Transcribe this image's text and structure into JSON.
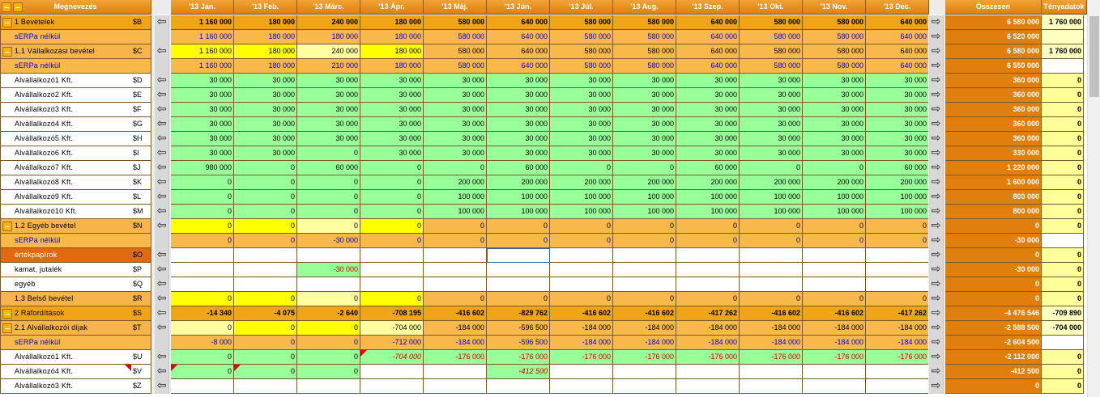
{
  "header": {
    "name": "Megnevezés",
    "months": [
      "'13 Jan.",
      "'13 Feb.",
      "'13 Márc.",
      "'13 Ápr.",
      "'13 Máj.",
      "'13 Jún.",
      "'13 Júl.",
      "'13 Aug.",
      "'13 Szep.",
      "'13 Okt.",
      "'13 Nov.",
      "'13 Dec."
    ],
    "sum": "Összesen",
    "actual": "Tényadatok"
  },
  "icons": {
    "arrow_left": "left-arrow-icon",
    "arrow_right": "right-arrow-icon",
    "collapse": "minus-icon"
  },
  "colors": {
    "header": "#e58e16",
    "total": "#e07f0d",
    "green": "#99ff99",
    "light_yellow": "#ffff99",
    "yellow": "#ffff00",
    "orange": "#f0a020",
    "light_orange": "#f8b84a",
    "blue_text": "#0000cc",
    "red_text": "#cc0000"
  },
  "rows": [
    {
      "label": "1 Bevételek",
      "key": "$B",
      "collapse": true,
      "style": "orange",
      "values": [
        "1 160 000",
        "180 000",
        "240 000",
        "180 000",
        "580 000",
        "640 000",
        "580 000",
        "580 000",
        "640 000",
        "580 000",
        "580 000",
        "640 000"
      ],
      "sum": "6 580 000",
      "actual": "1 760 000",
      "actual_bg": "#ffffc0"
    },
    {
      "label": "sERPa nélkül",
      "key": "",
      "style": "serpa",
      "values": [
        "1 160 000",
        "180 000",
        "180 000",
        "180 000",
        "580 000",
        "640 000",
        "580 000",
        "580 000",
        "640 000",
        "580 000",
        "580 000",
        "640 000"
      ],
      "sum": "6 520 000",
      "actual": "",
      "actual_bg": "#ffffc0"
    },
    {
      "label": "1.1 Vállalkozási bevétel",
      "key": "$C",
      "collapse": true,
      "style": "orange2",
      "values": [
        "1 160 000",
        "180 000",
        "240 000",
        "180 000",
        "580 000",
        "640 000",
        "580 000",
        "580 000",
        "640 000",
        "580 000",
        "580 000",
        "640 000"
      ],
      "cellbg": [
        "#ffff00",
        "#ffff00",
        "#ffffa0",
        "#ffff00",
        "",
        "",
        "",
        "",
        "",
        "",
        "",
        ""
      ],
      "sum": "6 580 000",
      "actual": "1 760 000",
      "actual_bg": "#ffffc0"
    },
    {
      "label": "sERPa nélkül",
      "key": "",
      "style": "serpa",
      "values": [
        "1 160 000",
        "180 000",
        "210 000",
        "180 000",
        "580 000",
        "640 000",
        "580 000",
        "580 000",
        "640 000",
        "580 000",
        "580 000",
        "640 000"
      ],
      "sum": "6 550 000",
      "actual": "",
      "actual_bg": "#ffffff"
    },
    {
      "label": "Alvállalkozó1 Kft.",
      "key": "$D",
      "style": "green",
      "values": [
        "30 000",
        "30 000",
        "30 000",
        "30 000",
        "30 000",
        "30 000",
        "30 000",
        "30 000",
        "30 000",
        "30 000",
        "30 000",
        "30 000"
      ],
      "sum": "360 000",
      "actual": "0"
    },
    {
      "label": "Alvállalkozó2 Kft.",
      "key": "$E",
      "style": "green",
      "values": [
        "30 000",
        "30 000",
        "30 000",
        "30 000",
        "30 000",
        "30 000",
        "30 000",
        "30 000",
        "30 000",
        "30 000",
        "30 000",
        "30 000"
      ],
      "sum": "360 000",
      "actual": "0"
    },
    {
      "label": "Alvállalkozó3 Kft.",
      "key": "$F",
      "style": "green",
      "values": [
        "30 000",
        "30 000",
        "30 000",
        "30 000",
        "30 000",
        "30 000",
        "30 000",
        "30 000",
        "30 000",
        "30 000",
        "30 000",
        "30 000"
      ],
      "sum": "360 000",
      "actual": "0"
    },
    {
      "label": "Alvállalkozó4 Kft.",
      "key": "$G",
      "style": "green",
      "values": [
        "30 000",
        "30 000",
        "30 000",
        "30 000",
        "30 000",
        "30 000",
        "30 000",
        "30 000",
        "30 000",
        "30 000",
        "30 000",
        "30 000"
      ],
      "sum": "360 000",
      "actual": "0"
    },
    {
      "label": "Alvállalkozó5 Kft.",
      "key": "$H",
      "style": "green",
      "values": [
        "30 000",
        "30 000",
        "30 000",
        "30 000",
        "30 000",
        "30 000",
        "30 000",
        "30 000",
        "30 000",
        "30 000",
        "30 000",
        "30 000"
      ],
      "sum": "360 000",
      "actual": "0"
    },
    {
      "label": "Alvállalkozó6 Kft.",
      "key": "$I",
      "style": "green",
      "values": [
        "30 000",
        "30 000",
        "0",
        "30 000",
        "30 000",
        "30 000",
        "30 000",
        "30 000",
        "30 000",
        "30 000",
        "30 000",
        "30 000"
      ],
      "sum": "330 000",
      "actual": "0"
    },
    {
      "label": "Alvállalkozó7 Kft.",
      "key": "$J",
      "style": "green",
      "values": [
        "980 000",
        "0",
        "60 000",
        "0",
        "0",
        "60 000",
        "0",
        "0",
        "60 000",
        "0",
        "0",
        "60 000"
      ],
      "sum": "1 220 000",
      "actual": "0"
    },
    {
      "label": "Alvállalkozó8 Kft.",
      "key": "$K",
      "style": "green",
      "values": [
        "0",
        "0",
        "0",
        "0",
        "200 000",
        "200 000",
        "200 000",
        "200 000",
        "200 000",
        "200 000",
        "200 000",
        "200 000"
      ],
      "sum": "1 600 000",
      "actual": "0"
    },
    {
      "label": "Alvállalkozó9 Kft.",
      "key": "$L",
      "style": "green",
      "values": [
        "0",
        "0",
        "0",
        "0",
        "100 000",
        "100 000",
        "100 000",
        "100 000",
        "100 000",
        "100 000",
        "100 000",
        "100 000"
      ],
      "sum": "800 000",
      "actual": "0"
    },
    {
      "label": "Alvállalkozó10 Kft.",
      "key": "$M",
      "style": "green",
      "values": [
        "0",
        "0",
        "0",
        "0",
        "100 000",
        "100 000",
        "100 000",
        "100 000",
        "100 000",
        "100 000",
        "100 000",
        "100 000"
      ],
      "sum": "800 000",
      "actual": "0"
    },
    {
      "label": "1.2 Egyéb bevétel",
      "key": "$N",
      "collapse": true,
      "style": "orange2",
      "values": [
        "0",
        "0",
        "0",
        "0",
        "0",
        "0",
        "0",
        "0",
        "0",
        "0",
        "0",
        "0"
      ],
      "cellbg": [
        "#ffff00",
        "#ffff00",
        "#ffffa0",
        "#ffff00",
        "",
        "",
        "",
        "",
        "",
        "",
        "",
        ""
      ],
      "sum": "0",
      "actual": "0"
    },
    {
      "label": "sERPa nélkül",
      "key": "",
      "style": "serpa",
      "values": [
        "0",
        "0",
        "-30 000",
        "0",
        "0",
        "0",
        "0",
        "0",
        "0",
        "0",
        "0",
        "0"
      ],
      "sum": "-30 000",
      "actual": "",
      "actual_bg": "#ffffff"
    },
    {
      "label": "értékpapírok",
      "key": "$O",
      "style": "white",
      "namebg": "#e06a10",
      "values": [
        "",
        "",
        "",
        "",
        "",
        "",
        "",
        "",
        "",
        "",
        "",
        ""
      ],
      "sum": "0",
      "actual": "0"
    },
    {
      "label": "kamat, jutalék",
      "key": "$P",
      "style": "white",
      "values": [
        "",
        "",
        "-30 000",
        "",
        "",
        "",
        "",
        "",
        "",
        "",
        "",
        ""
      ],
      "cellbg": [
        "",
        "",
        "#99ff99",
        "",
        "",
        "",
        "",
        "",
        "",
        "",
        "",
        ""
      ],
      "red": [
        2
      ],
      "sum": "-30 000",
      "actual": "0"
    },
    {
      "label": "egyéb",
      "key": "$Q",
      "style": "white",
      "values": [
        "",
        "",
        "",
        "",
        "",
        "",
        "",
        "",
        "",
        "",
        "",
        ""
      ],
      "sum": "0",
      "actual": "0"
    },
    {
      "label": "1.3 Belső bevétel",
      "key": "$R",
      "style": "orange2",
      "values": [
        "0",
        "0",
        "0",
        "0",
        "0",
        "0",
        "0",
        "0",
        "0",
        "0",
        "0",
        "0"
      ],
      "cellbg": [
        "#ffff00",
        "#ffff00",
        "#ffffa0",
        "#ffff00",
        "",
        "",
        "",
        "",
        "",
        "",
        "",
        ""
      ],
      "sum": "0",
      "actual": "0"
    },
    {
      "label": "2 Ráfordítások",
      "key": "$S",
      "collapse": true,
      "style": "orange",
      "values": [
        "-14 340",
        "-4 075",
        "-2 640",
        "-708 195",
        "-416 602",
        "-829 762",
        "-416 602",
        "-416 602",
        "-417 262",
        "-416 602",
        "-416 602",
        "-417 262"
      ],
      "sum": "-4 476 546",
      "actual": "-709 890",
      "actual_bg": "#ffffc0"
    },
    {
      "label": "2.1 Alvállalkozói díjak",
      "key": "$T",
      "collapse": true,
      "style": "orange2",
      "values": [
        "0",
        "0",
        "0",
        "-704 000",
        "-184 000",
        "-596 500",
        "-184 000",
        "-184 000",
        "-184 000",
        "-184 000",
        "-184 000",
        "-184 000"
      ],
      "cellbg": [
        "#ffffa0",
        "#ffff00",
        "#ffff00",
        "#ffffa0",
        "",
        "",
        "",
        "",
        "",
        "",
        "",
        ""
      ],
      "sum": "-2 588 500",
      "actual": "-704 000",
      "actual_bg": "#ffffc0"
    },
    {
      "label": "sERPa nélkül",
      "key": "",
      "style": "serpa",
      "values": [
        "-8 000",
        "0",
        "0",
        "-712 000",
        "-184 000",
        "-596 500",
        "-184 000",
        "-184 000",
        "-184 000",
        "-184 000",
        "-184 000",
        "-184 000"
      ],
      "sum": "-2 604 500",
      "actual": "",
      "actual_bg": "#ffffff"
    },
    {
      "label": "Alvállalkozó1 Kft.",
      "key": "$U",
      "style": "green",
      "values": [
        "0",
        "0",
        "0",
        "-704 000",
        "-176 000",
        "-176 000",
        "-176 000",
        "-176 000",
        "-176 000",
        "-176 000",
        "-176 000",
        "-176 000"
      ],
      "red": [
        3,
        4,
        5,
        6,
        7,
        8,
        9,
        10,
        11
      ],
      "italic": [
        3
      ],
      "sum": "-2 112 000",
      "actual": "0"
    },
    {
      "label": "Alvállalkozó4 Kft.",
      "key": "$V",
      "style": "green",
      "values": [
        "0",
        "0",
        "0",
        "",
        "",
        "-412 500",
        "",
        "",
        "",
        "",
        "",
        ""
      ],
      "cellbg": [
        "",
        "",
        "",
        "#ffffff",
        "#ffffff",
        "#99ff99",
        "#ffffff",
        "#ffffff",
        "#ffffff",
        "#ffffff",
        "#ffffff",
        "#ffffff"
      ],
      "red": [
        5
      ],
      "italic": [
        5
      ],
      "sum": "-412 500",
      "actual": "0"
    },
    {
      "label": "Alvállalkozó3 Kft.",
      "key": "$Z",
      "style": "green",
      "values": [
        "",
        "",
        "",
        "",
        "",
        "",
        "",
        "",
        "",
        "",
        "",
        ""
      ],
      "cellbg": [
        "#ffffff",
        "#ffffff",
        "#ffffff",
        "#ffffff",
        "#ffffff",
        "#ffffff",
        "#ffffff",
        "#ffffff",
        "#ffffff",
        "#ffffff",
        "#ffffff",
        "#ffffff"
      ],
      "sum": "0",
      "actual": "0"
    }
  ]
}
